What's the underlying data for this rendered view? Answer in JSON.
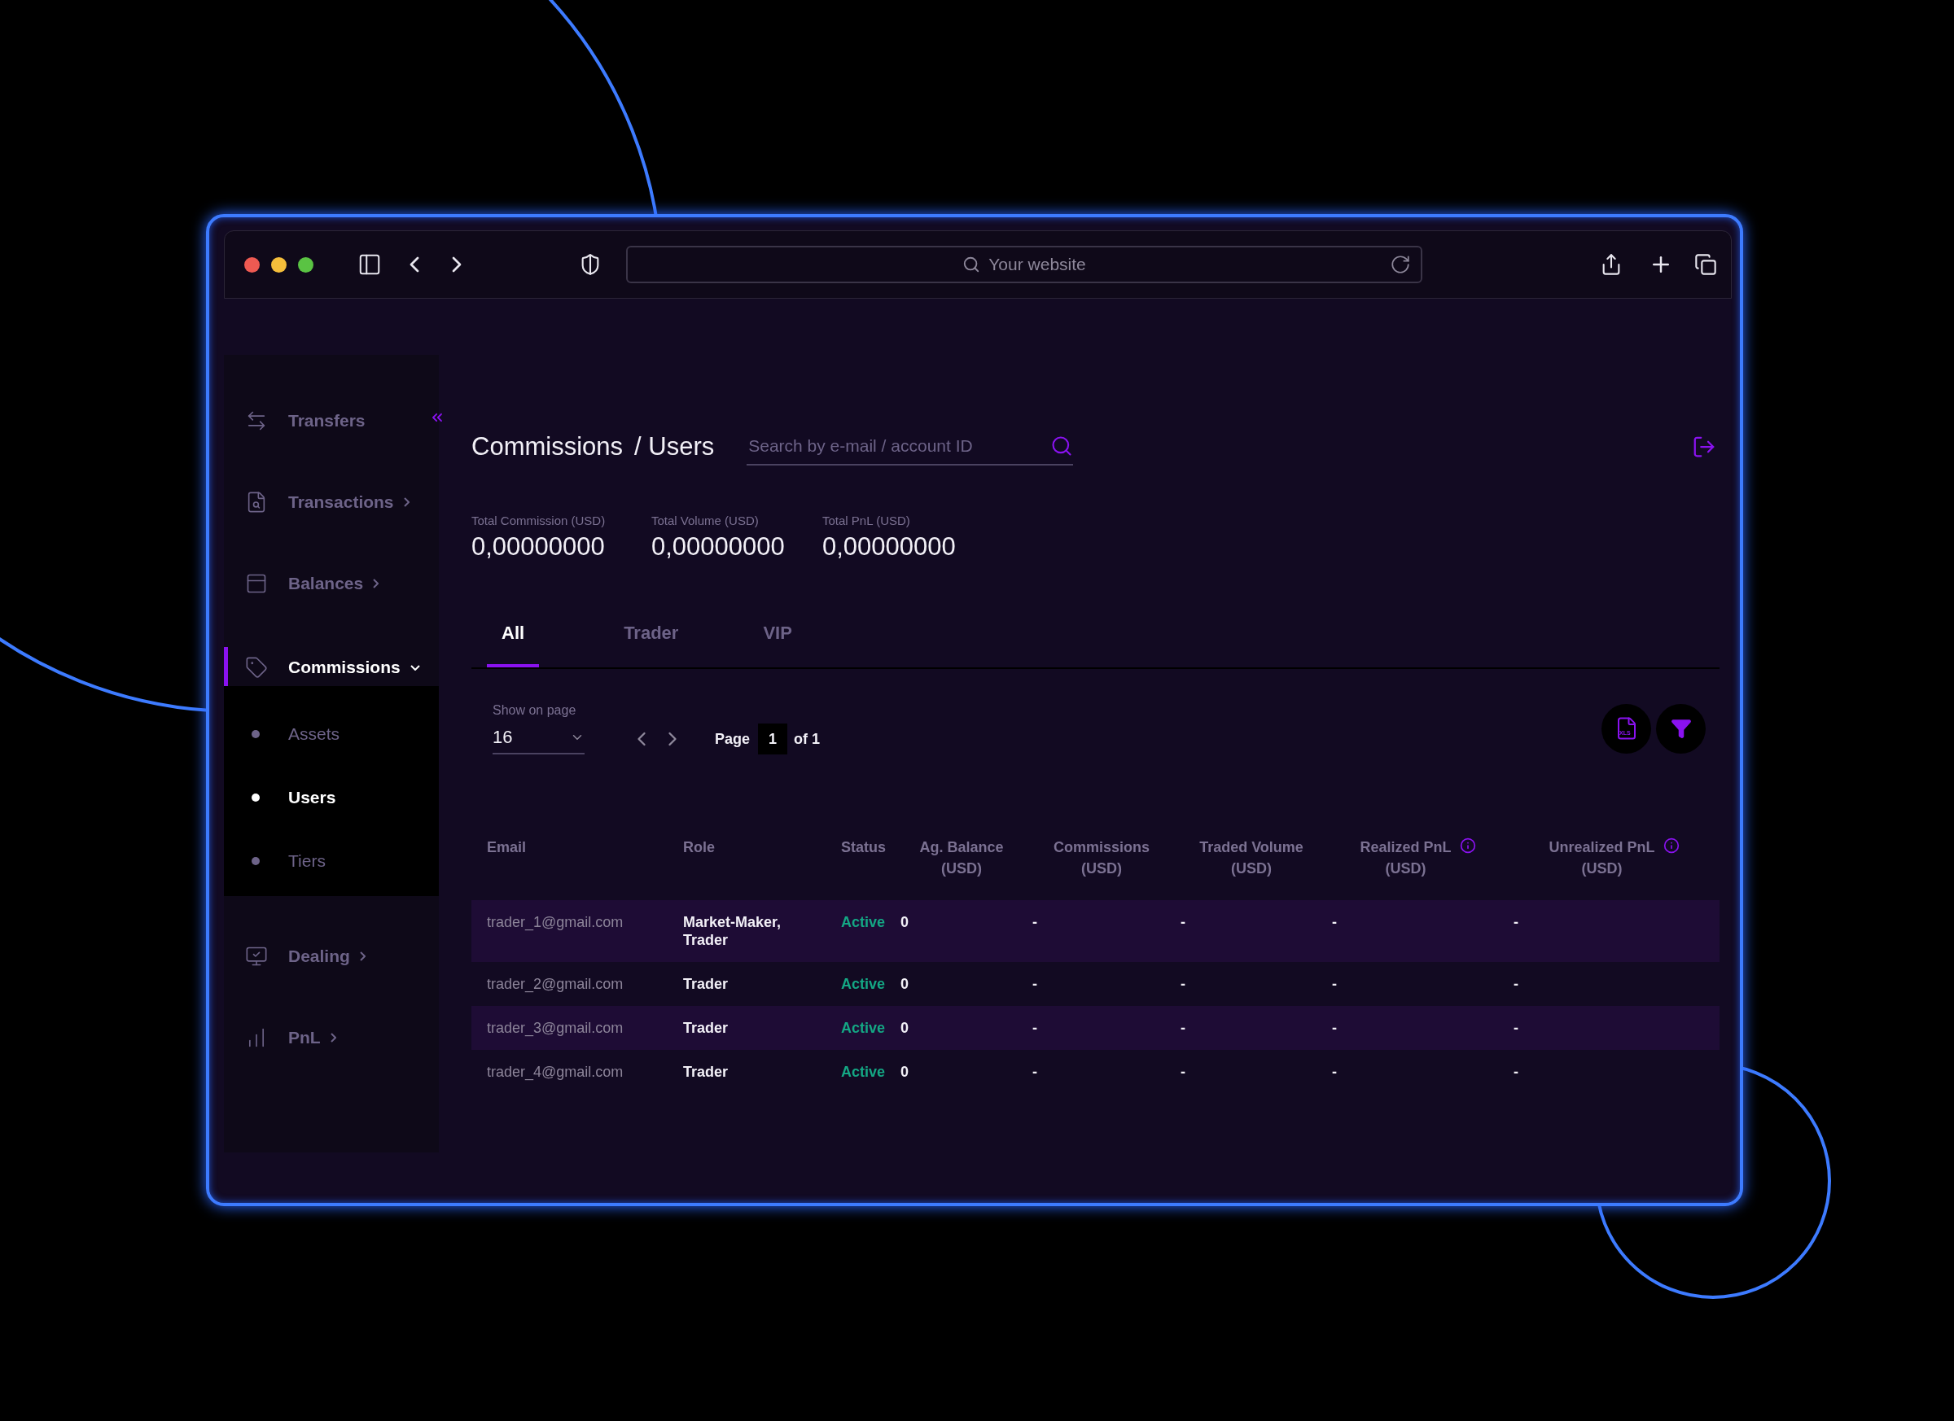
{
  "browser": {
    "address_placeholder": "Your website"
  },
  "sidebar": {
    "items": [
      {
        "label": "Transfers",
        "expandable": false,
        "selected": false
      },
      {
        "label": "Transactions",
        "expandable": true,
        "expanded": false,
        "selected": false
      },
      {
        "label": "Balances",
        "expandable": true,
        "expanded": false,
        "selected": false
      },
      {
        "label": "Commissions",
        "expandable": true,
        "expanded": true,
        "selected": true,
        "children": [
          {
            "label": "Assets",
            "selected": false
          },
          {
            "label": "Users",
            "selected": true
          },
          {
            "label": "Tiers",
            "selected": false
          }
        ]
      },
      {
        "label": "Dealing",
        "expandable": true,
        "expanded": false,
        "selected": false
      },
      {
        "label": "PnL",
        "expandable": true,
        "expanded": false,
        "selected": false
      }
    ]
  },
  "header": {
    "title": "Commissions",
    "crumb": "/ Users",
    "search_placeholder": "Search by e-mail / account ID"
  },
  "totals": [
    {
      "label": "Total Commission (USD)",
      "value": "0,00000000"
    },
    {
      "label": "Total Volume (USD)",
      "value": "0,00000000"
    },
    {
      "label": "Total PnL (USD)",
      "value": "0,00000000"
    }
  ],
  "tabs": [
    {
      "label": "All",
      "selected": true
    },
    {
      "label": "Trader",
      "selected": false
    },
    {
      "label": "VIP",
      "selected": false
    }
  ],
  "pagination": {
    "show_label": "Show on page",
    "per_page": "16",
    "page_label": "Page",
    "page": "1",
    "of_label": "of 1"
  },
  "export_button": {
    "label": "XLS"
  },
  "table": {
    "columns": [
      {
        "label": "Email",
        "info": false
      },
      {
        "label": "Role",
        "info": false
      },
      {
        "label": "Status",
        "info": false
      },
      {
        "label": "Ag. Balance",
        "unit": "(USD)",
        "info": false
      },
      {
        "label": "Commissions",
        "unit": "(USD)",
        "info": false
      },
      {
        "label": "Traded Volume",
        "unit": "(USD)",
        "info": false
      },
      {
        "label": "Realized PnL",
        "unit": "(USD)",
        "info": true
      },
      {
        "label": "Unrealized PnL",
        "unit": "(USD)",
        "info": true
      }
    ],
    "rows": [
      {
        "cells": [
          "trader_1@gmail.com",
          "Market-Maker, Trader",
          "Active",
          "0",
          "-",
          "-",
          "-",
          "-"
        ]
      },
      {
        "cells": [
          "trader_2@gmail.com",
          "Trader",
          "Active",
          "0",
          "-",
          "-",
          "-",
          "-"
        ]
      },
      {
        "cells": [
          "trader_3@gmail.com",
          "Trader",
          "Active",
          "0",
          "-",
          "-",
          "-",
          "-"
        ]
      },
      {
        "cells": [
          "trader_4@gmail.com",
          "Trader",
          "Active",
          "0",
          "-",
          "-",
          "-",
          "-"
        ]
      }
    ]
  }
}
